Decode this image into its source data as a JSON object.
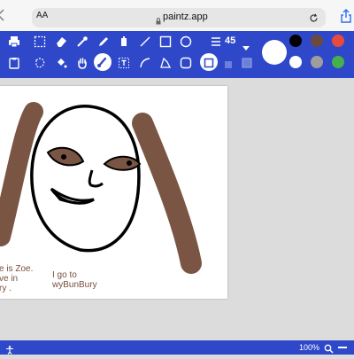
{
  "browser": {
    "aa_label": "AA",
    "url": "paintz.app"
  },
  "toolbar": {
    "brush_size": "45",
    "swatches": [
      "#000000",
      "#6b4a3e",
      "#e84b3c",
      "#ffffff",
      "#9e9e9e",
      "#46b04a"
    ],
    "icons_row1": [
      "print-icon",
      "rect-select-icon",
      "eraser-icon",
      "eyedropper-icon",
      "pencil-icon",
      "bucket-icon",
      "line-icon",
      "rectangle-icon",
      "ellipse-icon"
    ],
    "icons_row2": [
      "clipboard-icon",
      "free-select-icon",
      "fill-icon",
      "pan-hand-icon",
      "brush-icon",
      "text-icon",
      "curve-icon",
      "polygon-icon",
      "rounded-rect-icon"
    ],
    "accent": "#2f48c9"
  },
  "canvas": {
    "caption_left": [
      "e is Zoe.",
      "ve in",
      "ry ."
    ],
    "caption_right": [
      "I go to",
      "wyBunBury"
    ],
    "ink_brown": "#7a5543"
  },
  "status": {
    "zoom": "100%"
  }
}
